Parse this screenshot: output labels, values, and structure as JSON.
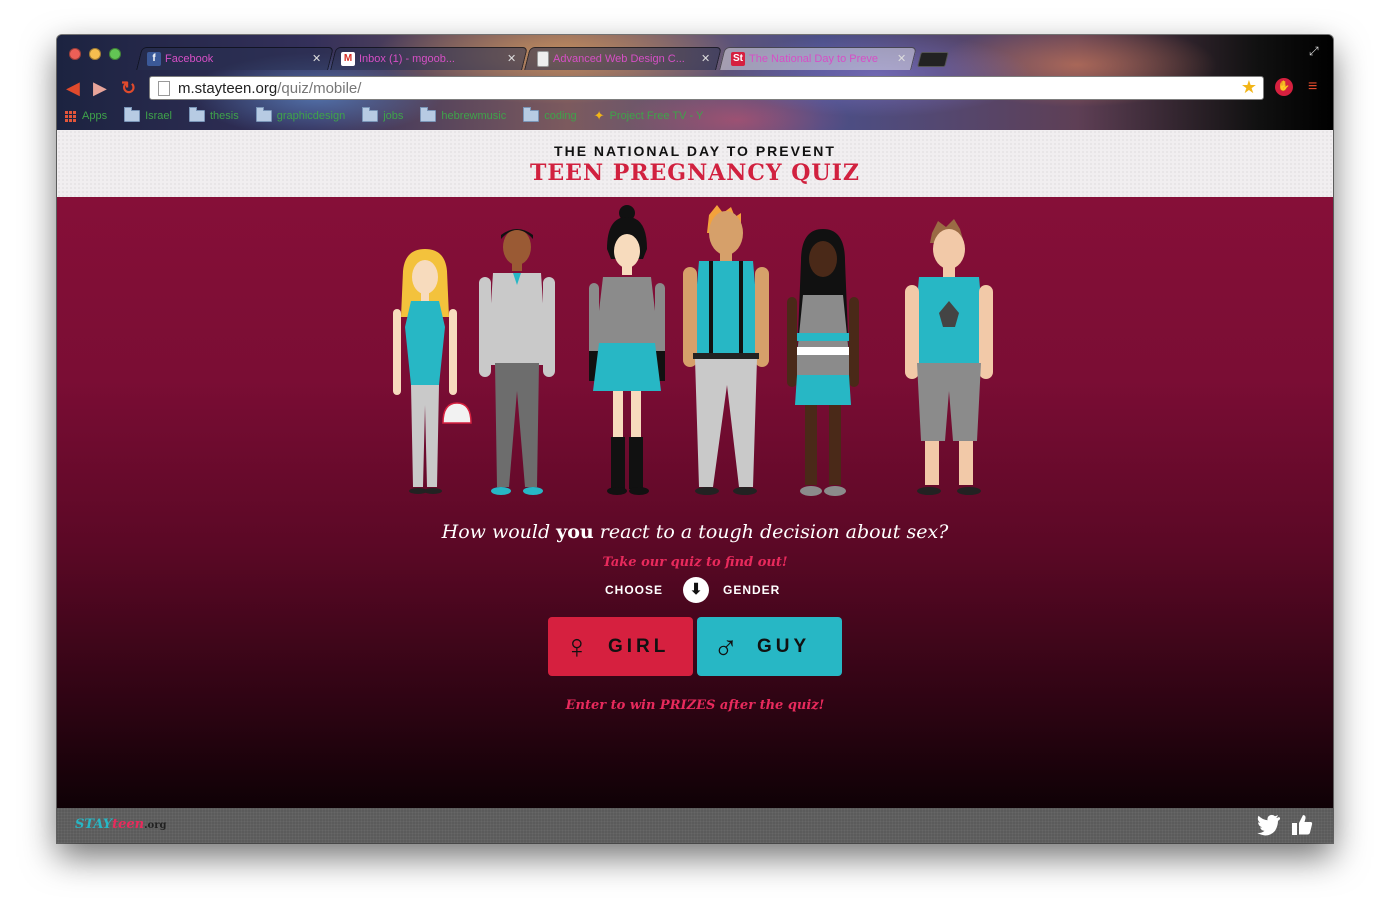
{
  "browser": {
    "tabs": [
      {
        "title": "Facebook",
        "favicon": "facebook-icon",
        "favicon_color": "#3b5998",
        "active": false
      },
      {
        "title": "Inbox (1) - mgoob...",
        "favicon": "gmail-icon",
        "favicon_color": "#d93025",
        "active": false
      },
      {
        "title": "Advanced Web Design C...",
        "favicon": "page-icon",
        "favicon_color": "#eeeeee",
        "active": false
      },
      {
        "title": "The National Day to Preve",
        "favicon": "stayteen-icon",
        "favicon_color": "#d6203f",
        "active": true
      }
    ],
    "url_host": "m.stayteen.org",
    "url_path": "/quiz/mobile/",
    "bookmarks": [
      {
        "label": "Apps",
        "icon": "apps-grid-icon"
      },
      {
        "label": "Israel",
        "icon": "folder-icon"
      },
      {
        "label": "thesis",
        "icon": "folder-icon"
      },
      {
        "label": "graphicdesign",
        "icon": "folder-icon"
      },
      {
        "label": "jobs",
        "icon": "folder-icon"
      },
      {
        "label": "hebrewmusic",
        "icon": "folder-icon"
      },
      {
        "label": "coding",
        "icon": "folder-icon"
      },
      {
        "label": "Project Free TV - Y",
        "icon": "projectfreetv-icon"
      }
    ]
  },
  "header": {
    "line1": "THE NATIONAL DAY TO PREVENT",
    "line2": "TEEN PREGNANCY QUIZ"
  },
  "main": {
    "question_before": "How would ",
    "question_bold": "you",
    "question_after": " react to a tough decision about sex?",
    "subtitle": "Take our quiz to find out!",
    "choose_label": "CHOOSE",
    "gender_label": "GENDER",
    "girl_symbol": "♀",
    "girl_label": "GIRL",
    "guy_symbol": "♂",
    "guy_label": "GUY",
    "prize_text": "Enter to win PRIZES after the quiz!"
  },
  "footer": {
    "logo_part1": "STAY",
    "logo_part2": "teen",
    "logo_part3": ".org"
  },
  "colors": {
    "brand_red": "#d6203f",
    "brand_teal": "#27b7c5",
    "accent_pink": "#e82a5c",
    "hero_top": "#860f38",
    "hero_bottom": "#0f0106"
  }
}
